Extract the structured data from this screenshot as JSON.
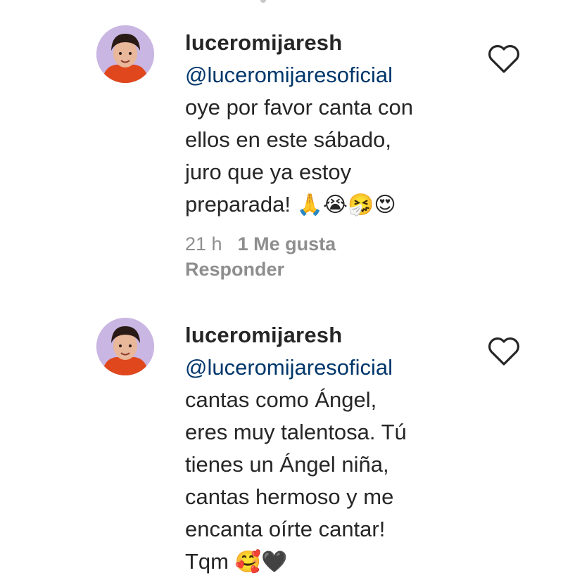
{
  "comments": [
    {
      "username": "luceromijaresh",
      "mention": "@luceromijaresoficial",
      "lines": [
        "oye por favor canta con",
        "ellos en este sábado,",
        "juro que ya estoy",
        "preparada!"
      ],
      "emoji": "🙏😭🤧😍",
      "time": "21 h",
      "likes": "1 Me gusta",
      "reply": "Responder",
      "icons": {
        "avatar": "avatar-photo",
        "like": "heart-outline-icon"
      }
    },
    {
      "username": "luceromijaresh",
      "mention": "@luceromijaresoficial",
      "lines": [
        "cantas como Ángel,",
        "eres muy talentosa. Tú",
        "tienes un Ángel niña,",
        "cantas hermoso y me",
        "encanta oírte cantar!",
        "Tqm"
      ],
      "emoji": "🥰🖤",
      "icons": {
        "avatar": "avatar-photo",
        "like": "heart-outline-icon"
      }
    }
  ],
  "colors": {
    "mention": "#00376b",
    "meta": "#8e8e8e",
    "text": "#262626"
  }
}
